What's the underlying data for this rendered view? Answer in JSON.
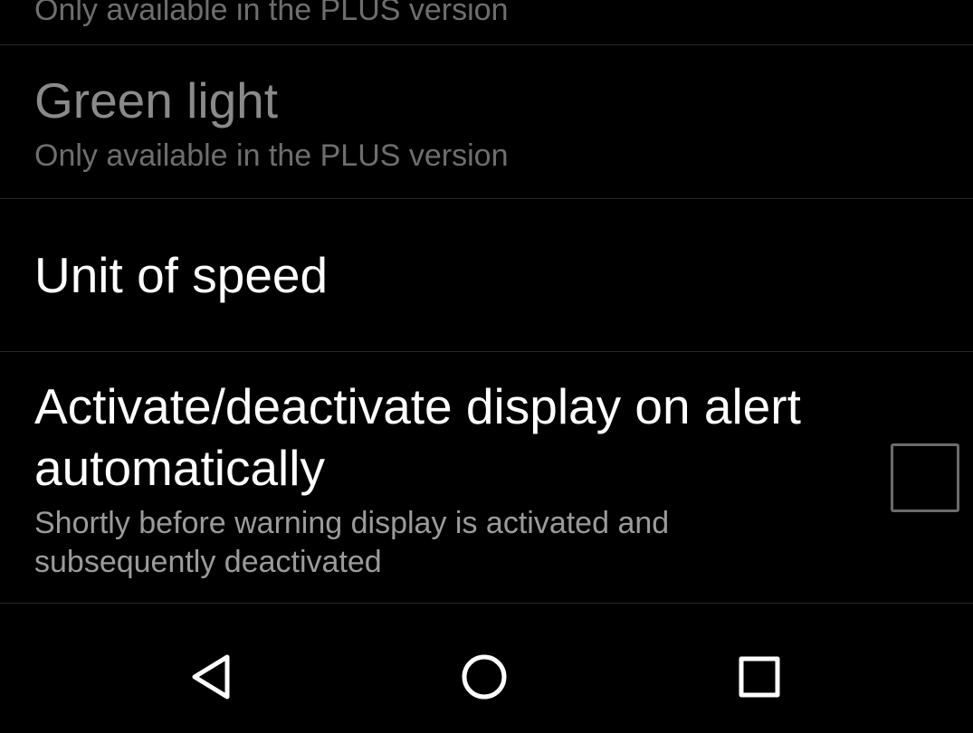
{
  "settings": {
    "previous_item": {
      "summary": "Only available in the PLUS version"
    },
    "green_light": {
      "title": "Green light",
      "summary": "Only available in the PLUS version"
    },
    "unit_of_speed": {
      "title": "Unit of speed"
    },
    "auto_display": {
      "title": "Activate/deactivate display on alert automatically",
      "summary": "Shortly before warning display is activated and subsequently deactivated",
      "checked": false
    }
  },
  "navigation_bar": {
    "buttons": [
      {
        "name": "back",
        "icon": "triangle-back-icon"
      },
      {
        "name": "home",
        "icon": "circle-home-icon"
      },
      {
        "name": "recents",
        "icon": "square-recents-icon"
      }
    ]
  },
  "colors": {
    "background": "#000000",
    "divider": "#262626",
    "title_enabled": "#ffffff",
    "title_disabled": "#8a8a8a",
    "summary": "#9b9b9b",
    "checkbox_border": "#6b6b6b"
  }
}
